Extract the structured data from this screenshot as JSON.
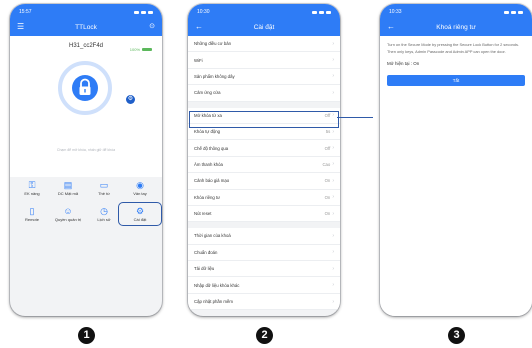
{
  "colors": {
    "primary": "#2e7cf6",
    "highlight": "#2f5aa8",
    "battery": "#5cb85c"
  },
  "phone1": {
    "time": "15:57",
    "title": "TTLock",
    "device_name": "H31_cc2F4d",
    "battery_text": "100%",
    "hint": "Chạm để mở khóa, nhấn giữ để khóa",
    "grid": [
      {
        "icon": "key-icon",
        "label": "EK nâng"
      },
      {
        "icon": "ic-card-icon",
        "label": "DC Mật mã"
      },
      {
        "icon": "card-icon",
        "label": "Thẻ từ"
      },
      {
        "icon": "fingerprint-icon",
        "label": "Vân tay"
      },
      {
        "icon": "remote-icon",
        "label": "Remote"
      },
      {
        "icon": "user-icon",
        "label": "Quyền quản trị"
      },
      {
        "icon": "history-icon",
        "label": "Lịch sử"
      },
      {
        "icon": "settings-icon",
        "label": "Cài đặt"
      }
    ]
  },
  "phone2": {
    "time": "10:30",
    "title": "Cài đặt",
    "group1": [
      {
        "label": "Những điều cơ bản",
        "value": ""
      },
      {
        "label": "WiFi",
        "value": ""
      },
      {
        "label": "Sản phẩm không dây",
        "value": ""
      },
      {
        "label": "Cảm ứng cửa",
        "value": ""
      }
    ],
    "group2": [
      {
        "label": "Mở khóa từ xa",
        "value": "Off"
      },
      {
        "label": "Khóa tự động",
        "value": "5s"
      },
      {
        "label": "Chế độ thông qua",
        "value": "Off"
      },
      {
        "label": "Âm thanh khóa",
        "value": "Cao"
      },
      {
        "label": "Cảnh báo giả mạo",
        "value": "On"
      },
      {
        "label": "Khóa riêng tư",
        "value": "On"
      },
      {
        "label": "Nút reset",
        "value": "On"
      }
    ],
    "group3": [
      {
        "label": "Thời gian của khoá",
        "value": ""
      },
      {
        "label": "Chuẩn đoán",
        "value": ""
      },
      {
        "label": "Tải dữ liệu",
        "value": ""
      },
      {
        "label": "Nhập dữ liệu khóa khác",
        "value": ""
      },
      {
        "label": "Cập nhật phần mềm",
        "value": ""
      }
    ]
  },
  "phone3": {
    "time": "10:33",
    "title": "Khoá riêng tư",
    "description": "Turn on the Secure Mode by pressing the Secure Lock Button for 2 seconds. Then only keys, Admin Passcode and Admin APP can open the door.",
    "current": "Mở hiện tại : On",
    "button": "Tắt"
  },
  "step_numbers": [
    "1",
    "2",
    "3"
  ]
}
